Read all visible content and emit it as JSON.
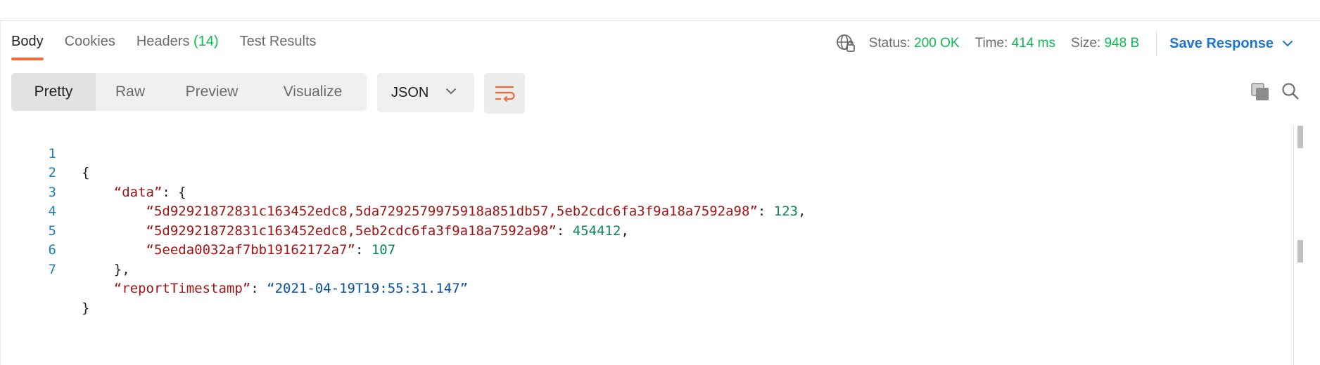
{
  "tabs": [
    {
      "label": "Body"
    },
    {
      "label": "Cookies"
    },
    {
      "label": "Headers",
      "count": "(14)"
    },
    {
      "label": "Test Results"
    }
  ],
  "status": {
    "status_label": "Status:",
    "status_value": "200 OK",
    "time_label": "Time:",
    "time_value": "414 ms",
    "size_label": "Size:",
    "size_value": "948 B",
    "save_label": "Save Response"
  },
  "view_modes": [
    "Pretty",
    "Raw",
    "Preview",
    "Visualize"
  ],
  "format": {
    "selected": "JSON"
  },
  "icons": {
    "network": "globe-lock-icon",
    "wrap": "wrap-lines-icon",
    "copy": "copy-icon",
    "search": "search-icon",
    "chevron": "chevron-down-icon"
  },
  "colors": {
    "accent": "#f26b3a",
    "status_ok": "#0cbb52",
    "link": "#1e74d3",
    "json_key": "#a31515",
    "json_number": "#098658",
    "json_string": "#0451a5",
    "line_number": "#1f7fb7"
  },
  "code": {
    "line_numbers": [
      "1",
      "2",
      "3",
      "4",
      "5",
      "6",
      "7"
    ],
    "open_brace": "{",
    "data_key": "“data”",
    "entries": [
      {
        "key": "“5d92921872831c163452edc8,5da7292579975918a851db57,5eb2cdc6fa3f9a18a7592a98”",
        "value": "123",
        "comma": ","
      },
      {
        "key": "“5d92921872831c163452edc8,5eb2cdc6fa3f9a18a7592a98”",
        "value": "454412",
        "comma": ","
      },
      {
        "key": "“5eeda0032af7bb19162172a7”",
        "value": "107",
        "comma": ""
      }
    ],
    "close_data": "},",
    "ts_key": "“reportTimestamp”",
    "ts_value": "“2021-04-19T19:55:31.147”",
    "close_brace": "}"
  }
}
